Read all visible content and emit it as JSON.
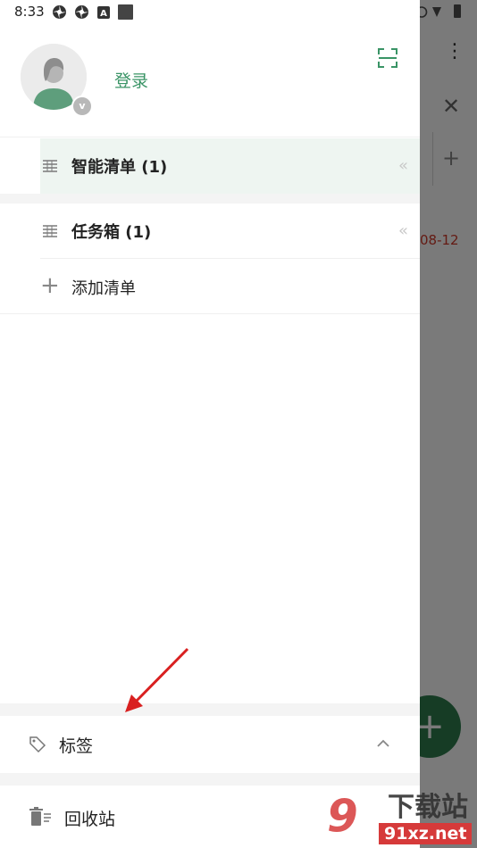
{
  "status_bar": {
    "time": "8:33"
  },
  "background_app": {
    "date_text": "08-12",
    "menu_icon": "more-vertical-icon",
    "close_icon": "close-icon",
    "add_icon": "plus-icon",
    "fab_icon": "plus-icon",
    "fab_color": "#2e7d4f",
    "date_color": "#d23a2a"
  },
  "drawer": {
    "login_label": "登录",
    "scan_icon": "scan-icon",
    "avatar_badge": "v",
    "lists": [
      {
        "label": "智能清单 (1)",
        "selected": true,
        "icon": "list-icon",
        "collapse_icon": "collapse-left-icon"
      },
      {
        "label": "任务箱 (1)",
        "selected": false,
        "icon": "list-icon",
        "collapse_icon": "collapse-left-icon"
      }
    ],
    "add_list_label": "添加清单",
    "tags_label": "标签",
    "trash_label": "回收站"
  },
  "watermark": {
    "mark": "9",
    "title": "下载站",
    "site": "91xz.net"
  },
  "colors": {
    "accent": "#3a9466",
    "selected_row": "#eef5f1",
    "annotation": "#d92020"
  }
}
